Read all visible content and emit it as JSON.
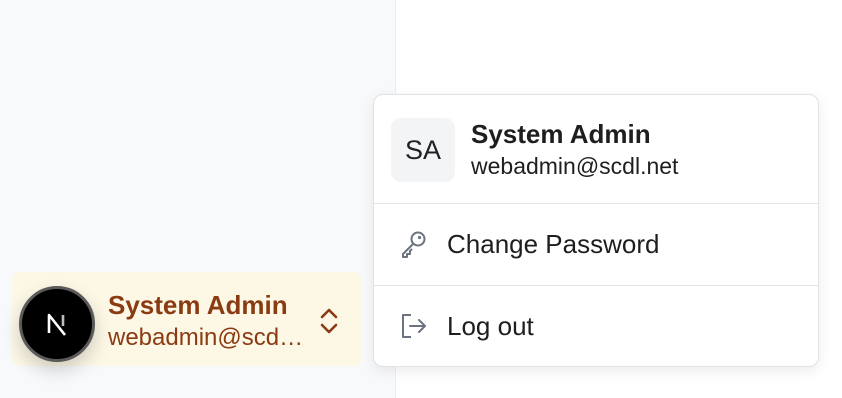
{
  "sidebar": {
    "user": {
      "avatar_letter": "N",
      "name": "System Admin",
      "email": "webadmin@scdl.net"
    }
  },
  "menu": {
    "initials": "SA",
    "name": "System Admin",
    "email": "webadmin@scdl.net",
    "items": [
      {
        "label": "Change Password",
        "icon": "key-icon"
      },
      {
        "label": "Log out",
        "icon": "logout-icon"
      }
    ]
  },
  "colors": {
    "card_bg": "#fdf7e6",
    "card_text": "#8a3b12",
    "icon": "#6b7280"
  }
}
